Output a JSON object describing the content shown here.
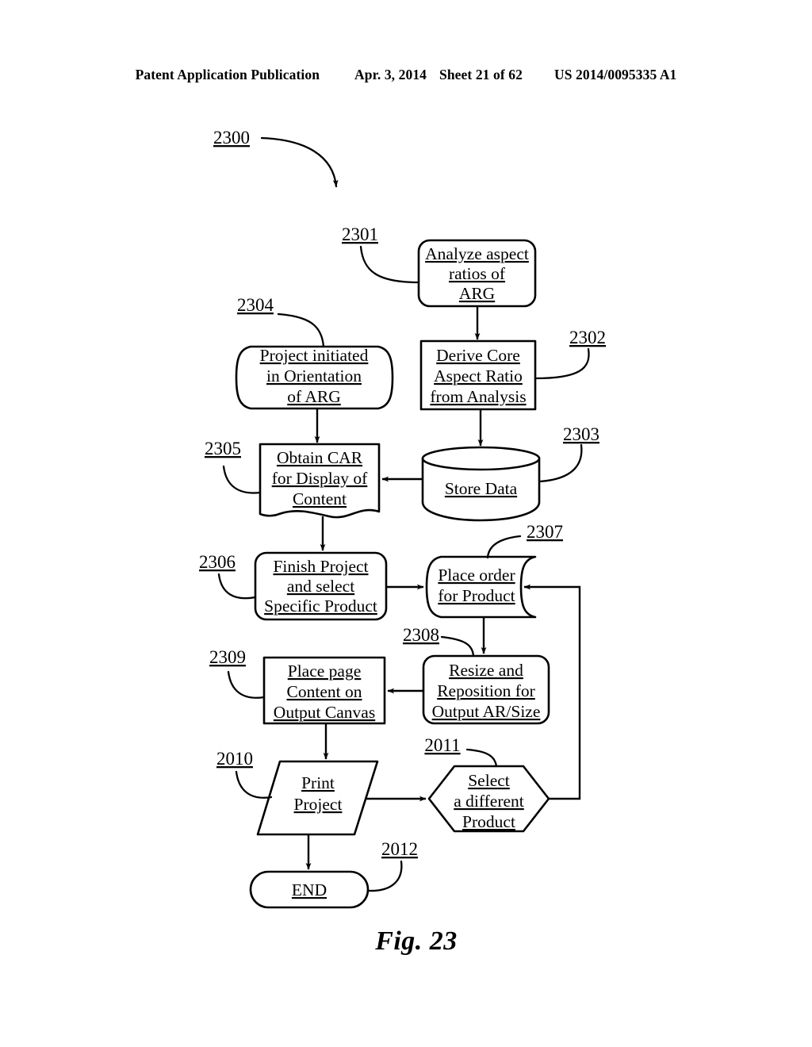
{
  "header": {
    "publication": "Patent Application Publication",
    "date": "Apr. 3, 2014",
    "sheet": "Sheet 21 of 62",
    "number": "US 2014/0095335 A1"
  },
  "figure": {
    "caption": "Fig. 23",
    "diagram_ref": "2300"
  },
  "diagram": {
    "type": "flowchart",
    "nodes": [
      {
        "ref": "2301",
        "shape": "rounded-rectangle",
        "lines": [
          "Analyze aspect",
          "ratios of",
          "ARG"
        ]
      },
      {
        "ref": "2302",
        "shape": "rectangle",
        "lines": [
          "Derive Core",
          "Aspect Ratio",
          "from Analysis"
        ]
      },
      {
        "ref": "2303",
        "shape": "cylinder",
        "lines": [
          "Store Data"
        ]
      },
      {
        "ref": "2304",
        "shape": "tape",
        "lines": [
          "Project initiated",
          "in Orientation",
          "of ARG"
        ]
      },
      {
        "ref": "2305",
        "shape": "document",
        "lines": [
          "Obtain CAR",
          "for Display of",
          "Content"
        ]
      },
      {
        "ref": "2306",
        "shape": "rounded-rectangle",
        "lines": [
          "Finish Project",
          "and select",
          "Specific Product"
        ]
      },
      {
        "ref": "2307",
        "shape": "tape",
        "lines": [
          "Place order",
          "for Product"
        ]
      },
      {
        "ref": "2308",
        "shape": "rounded-rectangle",
        "lines": [
          "Resize and",
          "Reposition for",
          "Output AR/Size"
        ]
      },
      {
        "ref": "2309",
        "shape": "rectangle",
        "lines": [
          "Place page",
          "Content on",
          "Output Canvas"
        ]
      },
      {
        "ref": "2010",
        "shape": "parallelogram",
        "lines": [
          "Print",
          "Project"
        ]
      },
      {
        "ref": "2011",
        "shape": "hexagon",
        "lines": [
          "Select",
          "a different",
          "Product"
        ]
      },
      {
        "ref": "2012",
        "shape": "stadium",
        "lines": [
          "END"
        ]
      }
    ],
    "labels": {
      "l2300": "2300",
      "l2301": "2301",
      "l2302": "2302",
      "l2303": "2303",
      "l2304": "2304",
      "l2305": "2305",
      "l2306": "2306",
      "l2307": "2307",
      "l2308": "2308",
      "l2309": "2309",
      "l2010": "2010",
      "l2011": "2011",
      "l2012": "2012"
    },
    "node_text": {
      "n2301_1": "Analyze aspect",
      "n2301_2": "ratios of",
      "n2301_3": "ARG",
      "n2302_1": "Derive Core",
      "n2302_2": "Aspect Ratio",
      "n2302_3": "from Analysis",
      "n2303_1": "Store Data",
      "n2304_1": "Project initiated",
      "n2304_2": "in Orientation",
      "n2304_3": "of ARG",
      "n2305_1": "Obtain CAR",
      "n2305_2": "for Display of",
      "n2305_3": "Content",
      "n2306_1": "Finish Project",
      "n2306_2": "and select",
      "n2306_3": "Specific Product",
      "n2307_1": "Place order",
      "n2307_2": "for Product",
      "n2308_1": "Resize and",
      "n2308_2": "Reposition for",
      "n2308_3": "Output AR/Size",
      "n2309_1": "Place page",
      "n2309_2": "Content on",
      "n2309_3": "Output Canvas",
      "n2010_1": "Print",
      "n2010_2": "Project",
      "n2011_1": "Select",
      "n2011_2": "a different",
      "n2011_3": "Product",
      "n2012_1": "END"
    },
    "colors": {
      "ink": "#000000",
      "paper": "#ffffff"
    }
  }
}
